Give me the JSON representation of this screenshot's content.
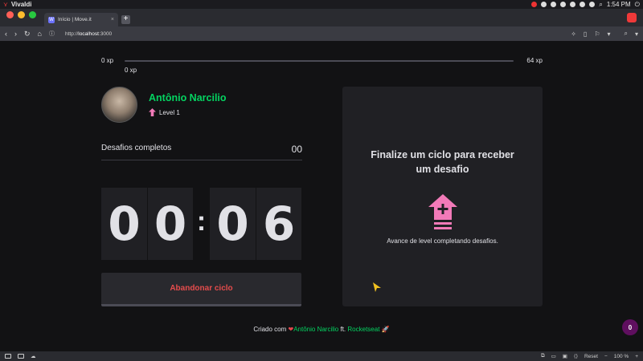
{
  "os": {
    "app_name": "Vivaldi",
    "clock": "1:54 PM"
  },
  "browser": {
    "tab_title": "Início | Move.it",
    "url_prefix": "http://",
    "url_host": "localhost",
    "url_suffix": ":3000",
    "zoom": "100 %",
    "reset_label": "Reset"
  },
  "xp": {
    "min": "0 xp",
    "max": "64 xp",
    "current": "0 xp",
    "progress_fraction": 0
  },
  "profile": {
    "name": "Antônio Narcilio",
    "level": "Level 1"
  },
  "completed": {
    "label": "Desafios completos",
    "count": "00"
  },
  "timer": {
    "m1": "0",
    "m2": "0",
    "separator": ":",
    "s1": "0",
    "s2": "6"
  },
  "abandon_label": "Abandonar ciclo",
  "challenge": {
    "title": "Finalize um ciclo para receber um desafio",
    "hint": "Avance de level completando desafios."
  },
  "footer": {
    "prefix": "Criado com",
    "heart": "❤",
    "author": "Antônio Narcilio",
    "ft": "ft.",
    "brand": "Rocketseat",
    "rocket": "🚀"
  },
  "notification_count": "0",
  "colors": {
    "accent_green": "#04d361",
    "danger_red": "#e54c4c",
    "card_bg": "#202024",
    "page_bg": "#121214",
    "level_pink": "#f27ab8"
  }
}
